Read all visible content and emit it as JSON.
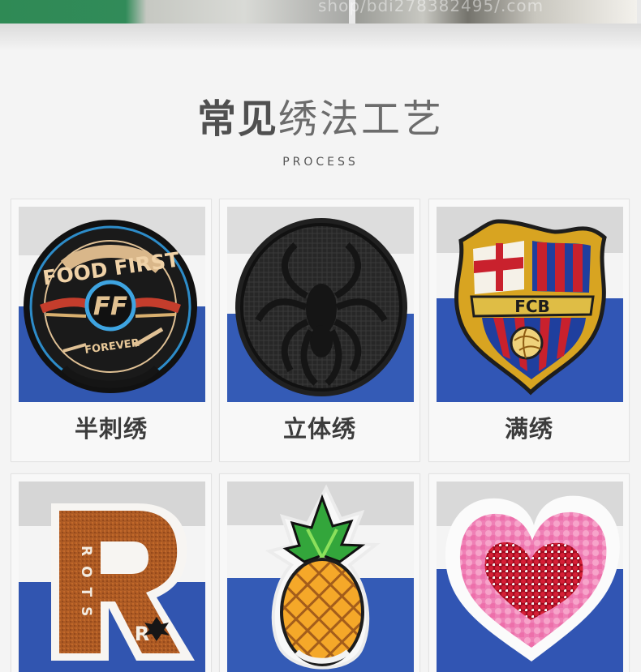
{
  "top_photo": {
    "watermark": "shop/bdi278382495/.com"
  },
  "header": {
    "title_strong": "常见",
    "title_light": "绣法工艺",
    "subtitle": "PROCESS"
  },
  "cards": [
    {
      "label": "半刺绣",
      "patch_text_top": "FOOD FIRST",
      "patch_monogram": "FF",
      "patch_text_bottom": "FOREVER"
    },
    {
      "label": "立体绣"
    },
    {
      "label": "满绣",
      "patch_text": "FCB"
    },
    {
      "letter": "R",
      "side_text": "ROTS"
    },
    {},
    {}
  ],
  "colors": {
    "page_bg": "#f4f4f4",
    "card_bg": "#f8f8f8",
    "fabric_blue": "#345bb6",
    "title_text": "#505050"
  },
  "icons": [
    "food-first-patch-icon",
    "spider-patch-icon",
    "fcb-crest-patch-icon",
    "r-chenille-patch-icon",
    "pineapple-patch-icon",
    "sequin-heart-patch-icon"
  ]
}
